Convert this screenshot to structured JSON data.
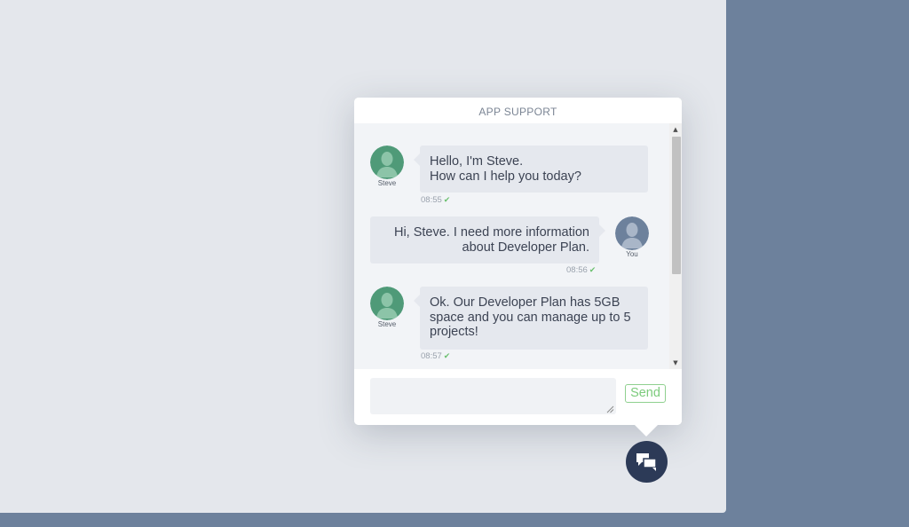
{
  "chat": {
    "title": "APP SUPPORT",
    "messages": [
      {
        "sender": "Steve",
        "side": "left",
        "text": "Hello, I'm Steve.\nHow can I help you today?",
        "time": "08:55"
      },
      {
        "sender": "You",
        "side": "right",
        "text": "Hi, Steve. I need more information about Developer Plan.",
        "time": "08:56"
      },
      {
        "sender": "Steve",
        "side": "left",
        "text": "Ok. Our Developer Plan has 5GB space and you can manage up to 5 projects!",
        "time": "08:57"
      }
    ],
    "input": {
      "value": "",
      "placeholder": ""
    },
    "send_label": "Send"
  },
  "colors": {
    "page_background": "#6d819c",
    "main_area": "#e4e7ec",
    "bubble": "#e5e8ee",
    "agent_avatar": "#4f9a78",
    "user_avatar": "#6d819c",
    "send_accent": "#7ccb7c",
    "toggle_button": "#2c3a57"
  },
  "icons": {
    "toggle": "chat-bubbles-icon",
    "read_receipt": "checkmark-icon",
    "avatar": "person-silhouette-icon"
  }
}
